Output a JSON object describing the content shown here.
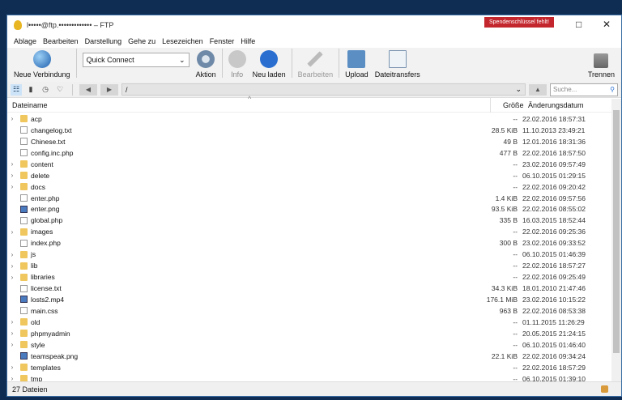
{
  "window": {
    "title": "l•••••@ftp.••••••••••••• – FTP",
    "donate_badge": "Spendenschlüssel fehlt!",
    "maximize_icon": "□",
    "close_icon": "✕",
    "accent": "#c4262e"
  },
  "menu": [
    "Ablage",
    "Bearbeiten",
    "Darstellung",
    "Gehe zu",
    "Lesezeichen",
    "Fenster",
    "Hilfe"
  ],
  "toolbar": {
    "new_connection": "Neue Verbindung",
    "quick_connect": "Quick Connect",
    "action": "Aktion",
    "info": "Info",
    "reload": "Neu laden",
    "edit": "Bearbeiten",
    "upload": "Upload",
    "transfers": "Dateitransfers",
    "disconnect": "Trennen"
  },
  "nav": {
    "path": "/",
    "search_placeholder": "Suche..."
  },
  "columns": {
    "name": "Dateiname",
    "size": "Größe",
    "date": "Änderungsdatum"
  },
  "files": [
    {
      "name": "acp",
      "type": "folder",
      "size": "--",
      "date": "22.02.2016 18:57:31"
    },
    {
      "name": "changelog.txt",
      "type": "file",
      "size": "28.5 KiB",
      "date": "11.10.2013 23:49:21"
    },
    {
      "name": "Chinese.txt",
      "type": "file",
      "size": "49 B",
      "date": "12.01.2016 18:31:36"
    },
    {
      "name": "config.inc.php",
      "type": "file",
      "size": "477 B",
      "date": "22.02.2016 18:57:50"
    },
    {
      "name": "content",
      "type": "folder",
      "size": "--",
      "date": "23.02.2016 09:57:49"
    },
    {
      "name": "delete",
      "type": "folder",
      "size": "--",
      "date": "06.10.2015 01:29:15"
    },
    {
      "name": "docs",
      "type": "folder",
      "size": "--",
      "date": "22.02.2016 09:20:42"
    },
    {
      "name": "enter.php",
      "type": "file",
      "size": "1.4 KiB",
      "date": "22.02.2016 09:57:56"
    },
    {
      "name": "enter.png",
      "type": "img",
      "size": "93.5 KiB",
      "date": "22.02.2016 08:55:02"
    },
    {
      "name": "global.php",
      "type": "file",
      "size": "335 B",
      "date": "16.03.2015 18:52:44"
    },
    {
      "name": "images",
      "type": "folder",
      "size": "--",
      "date": "22.02.2016 09:25:36"
    },
    {
      "name": "index.php",
      "type": "file",
      "size": "300 B",
      "date": "23.02.2016 09:33:52"
    },
    {
      "name": "js",
      "type": "folder",
      "size": "--",
      "date": "06.10.2015 01:46:39"
    },
    {
      "name": "lib",
      "type": "folder",
      "size": "--",
      "date": "22.02.2016 18:57:27"
    },
    {
      "name": "libraries",
      "type": "folder",
      "size": "--",
      "date": "22.02.2016 09:25:49"
    },
    {
      "name": "license.txt",
      "type": "file",
      "size": "34.3 KiB",
      "date": "18.01.2010 21:47:46"
    },
    {
      "name": "losts2.mp4",
      "type": "img",
      "size": "176.1 MiB",
      "date": "23.02.2016 10:15:22"
    },
    {
      "name": "main.css",
      "type": "file",
      "size": "963 B",
      "date": "22.02.2016 08:53:38"
    },
    {
      "name": "old",
      "type": "folder",
      "size": "--",
      "date": "01.11.2015 11:26:29"
    },
    {
      "name": "phpmyadmin",
      "type": "folder",
      "size": "--",
      "date": "20.05.2015 21:24:15"
    },
    {
      "name": "style",
      "type": "folder",
      "size": "--",
      "date": "06.10.2015 01:46:40"
    },
    {
      "name": "teamspeak.png",
      "type": "img",
      "size": "22.1 KiB",
      "date": "22.02.2016 09:34:24"
    },
    {
      "name": "templates",
      "type": "folder",
      "size": "--",
      "date": "22.02.2016 18:57:29"
    },
    {
      "name": "tmp",
      "type": "folder",
      "size": "--",
      "date": "06.10.2015 01:39:10"
    }
  ],
  "status": {
    "count": "27 Dateien"
  }
}
